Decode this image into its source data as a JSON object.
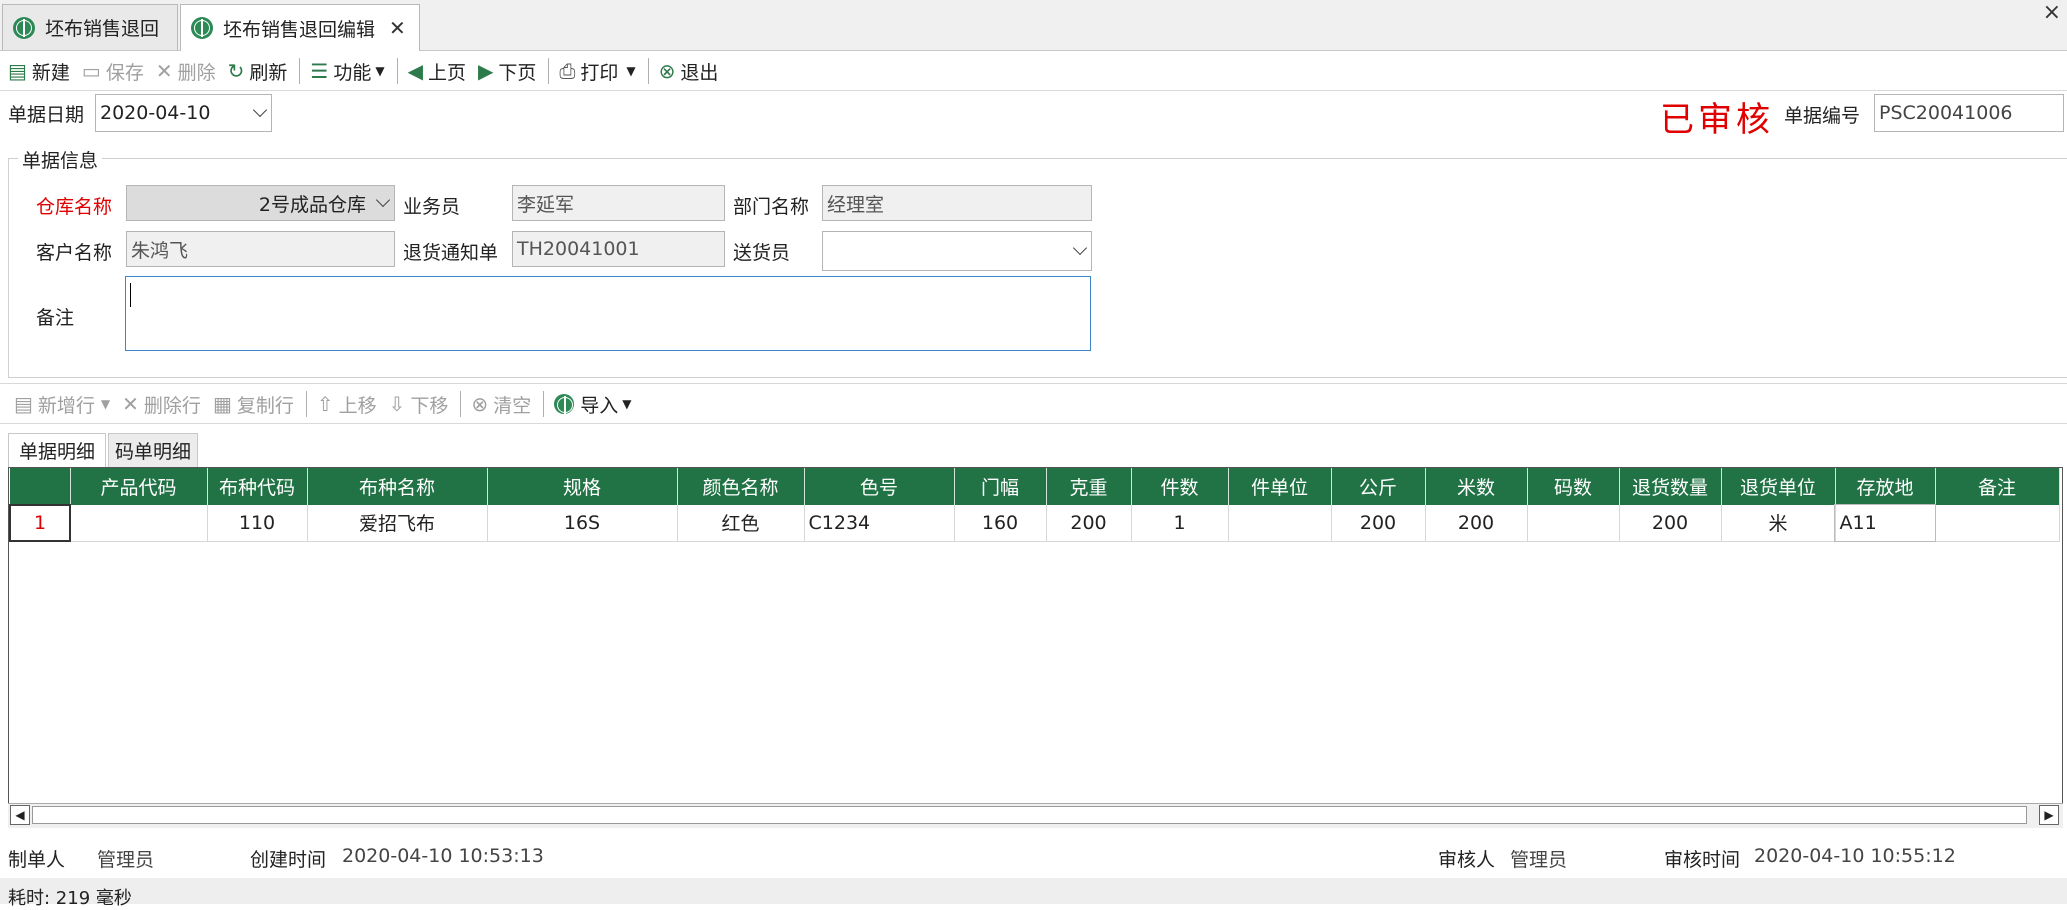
{
  "tabs": [
    {
      "label": "坯布销售退回"
    },
    {
      "label": "坯布销售退回编辑"
    }
  ],
  "window_close": "×",
  "toolbar": {
    "new": "新建",
    "save": "保存",
    "delete": "删除",
    "refresh": "刷新",
    "function": "功能",
    "prev": "上页",
    "next": "下页",
    "print": "打印",
    "exit": "退出"
  },
  "header": {
    "date_label": "单据日期",
    "date_value": "2020-04-10",
    "status": "已审核",
    "doc_no_label": "单据编号",
    "doc_no_value": "PSC20041006"
  },
  "doc_info": {
    "group_title": "单据信息",
    "warehouse_label": "仓库名称",
    "warehouse_value": "2号成品仓库",
    "salesman_label": "业务员",
    "salesman_value": "李延军",
    "dept_label": "部门名称",
    "dept_value": "经理室",
    "customer_label": "客户名称",
    "customer_value": "朱鸿飞",
    "return_notice_label": "退货通知单",
    "return_notice_value": "TH20041001",
    "deliverer_label": "送货员",
    "deliverer_value": "",
    "remark_label": "备注",
    "remark_value": ""
  },
  "detail_toolbar": {
    "add_row": "新增行",
    "delete_row": "删除行",
    "copy_row": "复制行",
    "move_up": "上移",
    "move_down": "下移",
    "clear": "清空",
    "import": "导入"
  },
  "subtabs": [
    {
      "label": "单据明细"
    },
    {
      "label": "码单明细"
    }
  ],
  "grid": {
    "columns": [
      "",
      "产品代码",
      "布种代码",
      "布种名称",
      "规格",
      "颜色名称",
      "色号",
      "门幅",
      "克重",
      "件数",
      "件单位",
      "公斤",
      "米数",
      "码数",
      "退货数量",
      "退货单位",
      "存放地",
      "备注"
    ],
    "rows": [
      [
        "1",
        "",
        "110",
        "爱招飞布",
        "16S",
        "红色",
        "C1234",
        "160",
        "200",
        "1",
        "",
        "200",
        "200",
        "",
        "200",
        "米",
        "A11",
        ""
      ]
    ]
  },
  "footer": {
    "creator_label": "制单人",
    "creator_value": "管理员",
    "created_label": "创建时间",
    "created_value": "2020-04-10 10:53:13",
    "auditor_label": "审核人",
    "auditor_value": "管理员",
    "audit_time_label": "审核时间",
    "audit_time_value": "2020-04-10 10:55:12"
  },
  "status_bar": "耗时: 219 毫秒",
  "colors": {
    "grid_header": "#217346",
    "status_stamp": "#e00000",
    "accent_green": "#2d8a57"
  }
}
